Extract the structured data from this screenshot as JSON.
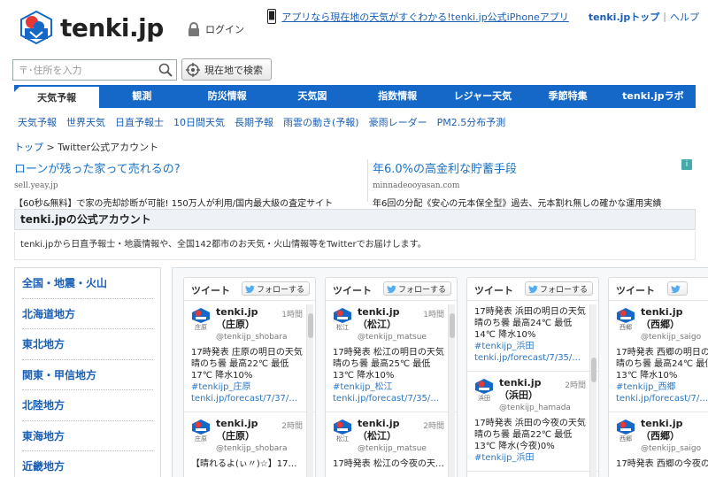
{
  "header": {
    "logo_text": "tenki.jp",
    "login_label": "ログイン",
    "app_link": "アプリなら現在地の天気がすぐわかる!tenki.jp公式iPhoneアプリ",
    "top_link": "tenki.jpトップ",
    "sep": "|",
    "help_link": "ヘルプ"
  },
  "search": {
    "placeholder": "〒･住所を入力",
    "locate_label": "現在地で検索"
  },
  "mainnav": [
    "天気予報",
    "観測",
    "防災情報",
    "天気図",
    "指数情報",
    "レジャー天気",
    "季節特集",
    "tenki.jpラボ"
  ],
  "subnav": [
    "天気予報",
    "世界天気",
    "日直予報士",
    "10日間天気",
    "長期予報",
    "雨雲の動き(予報)",
    "豪雨レーダー",
    "PM2.5分布予測"
  ],
  "breadcrumb": {
    "home": "トップ",
    "sep": ">",
    "current": "Twitter公式アカウント"
  },
  "ads": [
    {
      "title": "ローンが残った家って売れるの?",
      "domain": "sell.yeay.jp",
      "desc": "【60秒&無料】で家の売却診断が可能! 150万人が利用/国内最大級の査定サイト"
    },
    {
      "title": "年6.0%の高金利な貯蓄手段",
      "domain": "minnadeooyasan.com",
      "desc": "年6回の分配《安心の元本保全型》過去、元本割れ無しの確かな運用実績"
    }
  ],
  "ad_info": "i",
  "account": {
    "heading": "tenki.jpの公式アカウント",
    "desc": "tenki.jpから日直予報士・地震情報や、全国142都市のお天気・火山情報等をTwitterでお届けします。"
  },
  "sidebar": [
    "全国・地震・火山",
    "北海道地方",
    "東北地方",
    "関東・甲信地方",
    "北陸地方",
    "東海地方",
    "近畿地方"
  ],
  "timeline": {
    "title": "ツイート",
    "follow": "フォローする"
  },
  "timelines": [
    {
      "tweets": [
        {
          "name": "tenki.jp（庄原）",
          "cap": "庄原",
          "time": "1時間",
          "handle": "@tenkijp_shobara",
          "text": "17時発表 庄原の明日の天気 晴のち曇 最高22℃ 最低17℃ 降水10%",
          "tag": "#tenkijp_庄原",
          "url": "tenki.jp/forecast/7/37/…"
        },
        {
          "name": "tenki.jp（庄原）",
          "cap": "庄原",
          "time": "2時間",
          "handle": "@tenkijp_shobara",
          "text": "【晴れるよ(ぃ〃)☆】17…",
          "tag": "",
          "url": ""
        }
      ]
    },
    {
      "tweets": [
        {
          "name": "tenki.jp（松江）",
          "cap": "松江",
          "time": "1時間",
          "handle": "@tenkijp_matsue",
          "text": "17時発表 松江の明日の天気 晴のち曇 最高25℃ 最低13℃ 降水10%",
          "tag": "#tenkijp_松江",
          "url": "tenki.jp/forecast/7/35/…"
        },
        {
          "name": "tenki.jp（松江）",
          "cap": "松江",
          "time": "2時間",
          "handle": "@tenkijp_matsue",
          "text": "17時発表 松江の今夜の天…",
          "tag": "",
          "url": ""
        }
      ]
    },
    {
      "tweets": [
        {
          "name": "",
          "cap": "",
          "time": "",
          "handle": "",
          "text": "17時発表 浜田の明日の天気 晴のち曇 最高24℃ 最低14℃ 降水10%",
          "tag": "#tenkijp_浜田",
          "url": "tenki.jp/forecast/7/35/…"
        },
        {
          "name": "tenki.jp（浜田）",
          "cap": "浜田",
          "time": "2時間",
          "handle": "@tenkijp_hamada",
          "text": "17時発表 浜田の今夜の天気 晴のち曇 最高22℃ 最低13℃ 降水(今夜)0%",
          "tag": "#tenkijp_浜田",
          "url": ""
        }
      ]
    },
    {
      "tweets": [
        {
          "name": "tenki.jp（西郷）",
          "cap": "西郷",
          "time": "",
          "handle": "@tenkijp_saigo",
          "text": "17時発表 西郷の明日の天気 晴のち曇 最高24℃ 最低13℃ 降水10%",
          "tag": "#tenkijp_西郷",
          "url": "tenki.jp/forecast/7/…"
        },
        {
          "name": "tenki.jp（西郷）",
          "cap": "西郷",
          "time": "",
          "handle": "@tenkijp_saigo",
          "text": "17時発表 西郷の今夜の…",
          "tag": "",
          "url": ""
        }
      ]
    }
  ],
  "colors": {
    "nav_blue": "#1668c8",
    "link_blue": "#1a5fb4",
    "tweet_link": "#2a78c8"
  }
}
